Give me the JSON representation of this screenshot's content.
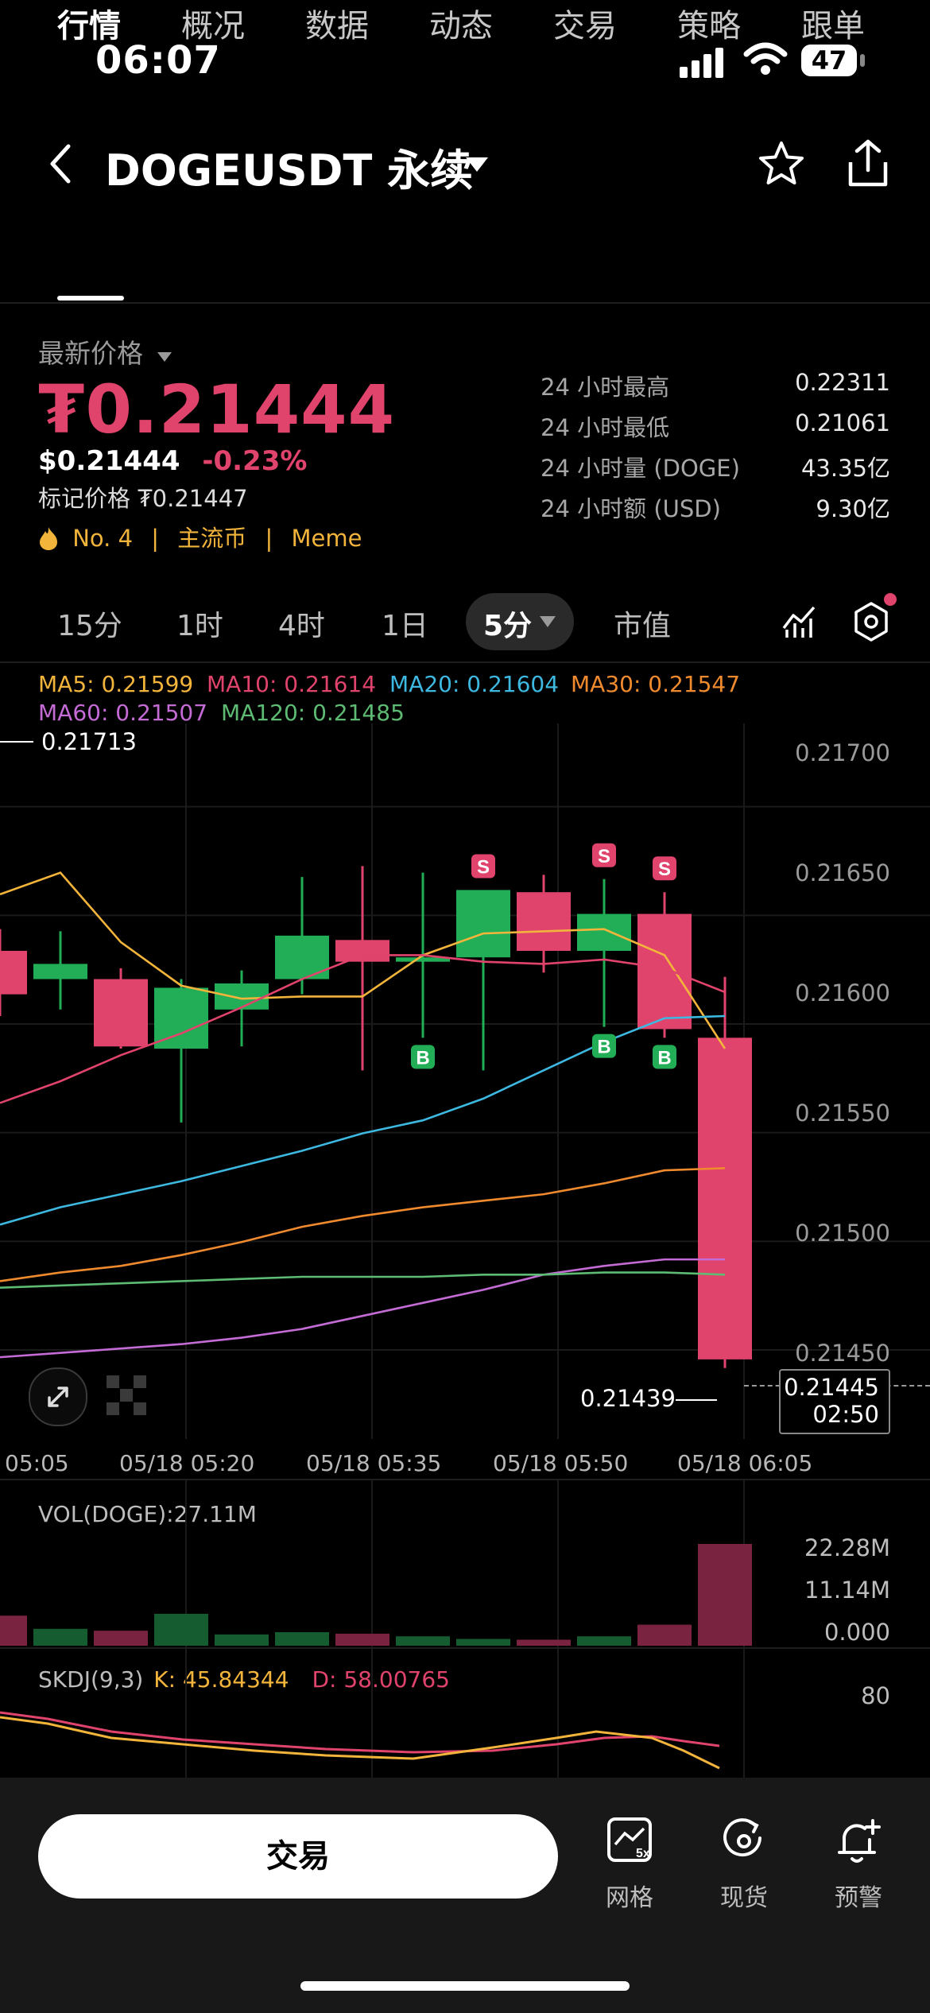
{
  "status": {
    "time": "06:07",
    "battery": "47"
  },
  "header": {
    "symbol": "DOGEUSDT",
    "suffix": "永续"
  },
  "tabs": [
    "行情",
    "概况",
    "数据",
    "动态",
    "交易",
    "策略",
    "跟单"
  ],
  "price": {
    "label": "最新价格",
    "main": "₮0.21444",
    "usd": "$0.21444",
    "change": "-0.23%",
    "mark": "标记价格 ₮0.21447",
    "rank": "No. 4",
    "tag1": "主流币",
    "tag2": "Meme"
  },
  "stats": [
    {
      "k": "24 小时最高",
      "v": "0.22311"
    },
    {
      "k": "24 小时最低",
      "v": "0.21061"
    },
    {
      "k": "24 小时量 (DOGE)",
      "v": "43.35亿"
    },
    {
      "k": "24 小时额 (USD)",
      "v": "9.30亿"
    }
  ],
  "timeframes": [
    "15分",
    "1时",
    "4时",
    "1日",
    "5分",
    "市值"
  ],
  "ma": {
    "ma5": "MA5: 0.21599",
    "ma10": "MA10: 0.21614",
    "ma20": "MA20: 0.21604",
    "ma30": "MA30: 0.21547",
    "ma60": "MA60: 0.21507",
    "ma120": "MA120: 0.21485"
  },
  "chart_data": {
    "type": "candlestick",
    "ylim": [
      0.2142,
      0.2172
    ],
    "y_ticks": [
      "0.21700",
      "0.21650",
      "0.21600",
      "0.21550",
      "0.21500",
      "0.21450"
    ],
    "x_ticks": [
      "05:05",
      "05/18 05:20",
      "05/18 05:35",
      "05/18 05:50",
      "05/18 06:05"
    ],
    "high_marker": "0.21713",
    "low_marker": "0.21439",
    "current_price": "0.21445",
    "countdown": "02:50",
    "candles": [
      {
        "o": 0.2163,
        "c": 0.2161,
        "h": 0.2164,
        "l": 0.216
      },
      {
        "o": 0.21617,
        "c": 0.21624,
        "h": 0.21639,
        "l": 0.21603
      },
      {
        "o": 0.21617,
        "c": 0.21586,
        "h": 0.21622,
        "l": 0.21585
      },
      {
        "o": 0.21585,
        "c": 0.21613,
        "h": 0.21617,
        "l": 0.21551
      },
      {
        "o": 0.21603,
        "c": 0.21615,
        "h": 0.21621,
        "l": 0.21586
      },
      {
        "o": 0.21617,
        "c": 0.21637,
        "h": 0.21664,
        "l": 0.2161
      },
      {
        "o": 0.21635,
        "c": 0.21625,
        "h": 0.21669,
        "l": 0.21575
      },
      {
        "o": 0.21625,
        "c": 0.21627,
        "h": 0.21666,
        "l": 0.2159
      },
      {
        "o": 0.21627,
        "c": 0.21658,
        "h": 0.21658,
        "l": 0.21575
      },
      {
        "o": 0.21657,
        "c": 0.2163,
        "h": 0.21665,
        "l": 0.2162
      },
      {
        "o": 0.2163,
        "c": 0.21647,
        "h": 0.21663,
        "l": 0.21595
      },
      {
        "o": 0.21647,
        "c": 0.21594,
        "h": 0.21657,
        "l": 0.2159
      },
      {
        "o": 0.2159,
        "c": 0.21442,
        "h": 0.21618,
        "l": 0.21438
      }
    ],
    "series": [
      {
        "values": [
          0.21656,
          0.21666,
          0.21634,
          0.21614,
          0.21608,
          0.21609,
          0.21609,
          0.21628,
          0.21638,
          0.21639,
          0.2164,
          0.21628,
          0.21585
        ]
      },
      {
        "values": [
          0.2156,
          0.2157,
          0.21582,
          0.21592,
          0.21604,
          0.21617,
          0.21628,
          0.21628,
          0.21625,
          0.21624,
          0.21626,
          0.21622,
          0.21611
        ]
      },
      {
        "values": [
          0.21504,
          0.21512,
          0.21518,
          0.21524,
          0.21531,
          0.21538,
          0.21546,
          0.21552,
          0.21562,
          0.21575,
          0.21588,
          0.21599,
          0.216
        ]
      },
      {
        "values": [
          0.21478,
          0.21482,
          0.21485,
          0.2149,
          0.21496,
          0.21503,
          0.21508,
          0.21512,
          0.21515,
          0.21518,
          0.21523,
          0.21529,
          0.2153
        ]
      },
      {
        "values": [
          0.21443,
          0.21445,
          0.21447,
          0.21449,
          0.21452,
          0.21456,
          0.21462,
          0.21468,
          0.21474,
          0.21481,
          0.21485,
          0.21488,
          0.21488
        ]
      },
      {
        "values": [
          0.21475,
          0.21476,
          0.21477,
          0.21478,
          0.21479,
          0.2148,
          0.2148,
          0.2148,
          0.21481,
          0.21481,
          0.21482,
          0.21482,
          0.21481
        ]
      }
    ],
    "signals": [
      {
        "i": 7,
        "side": "B"
      },
      {
        "i": 8,
        "side": "S"
      },
      {
        "i": 10,
        "side": "S"
      },
      {
        "i": 10,
        "side": "B"
      },
      {
        "i": 11,
        "side": "S"
      },
      {
        "i": 11,
        "side": "B"
      }
    ]
  },
  "volume": {
    "label": "VOL(DOGE):27.11M",
    "ticks": [
      "22.28M",
      "11.14M",
      "0.000"
    ],
    "max": 27.11,
    "values": [
      8.0,
      4.5,
      4.0,
      8.5,
      3.0,
      3.6,
      3.2,
      2.5,
      1.8,
      1.6,
      2.5,
      5.6,
      27.11
    ]
  },
  "skdj": {
    "label": "SKDJ(9,3)",
    "k": "K: 45.84344",
    "d": "D: 58.00765",
    "tick": "80"
  },
  "bottom": {
    "trade": "交易",
    "tools": [
      {
        "label": "网格",
        "icon": "grid-bot-icon"
      },
      {
        "label": "现货",
        "icon": "spot-icon"
      },
      {
        "label": "预警",
        "icon": "alert-bell-icon"
      }
    ]
  },
  "colors": {
    "up": "#22ae57",
    "down": "#e0436c",
    "ma5": "#f2b43b",
    "ma10": "#e0436c",
    "ma20": "#3db8e0",
    "ma30": "#f08a2e",
    "ma60": "#c46bd6",
    "ma120": "#5dbb73"
  }
}
